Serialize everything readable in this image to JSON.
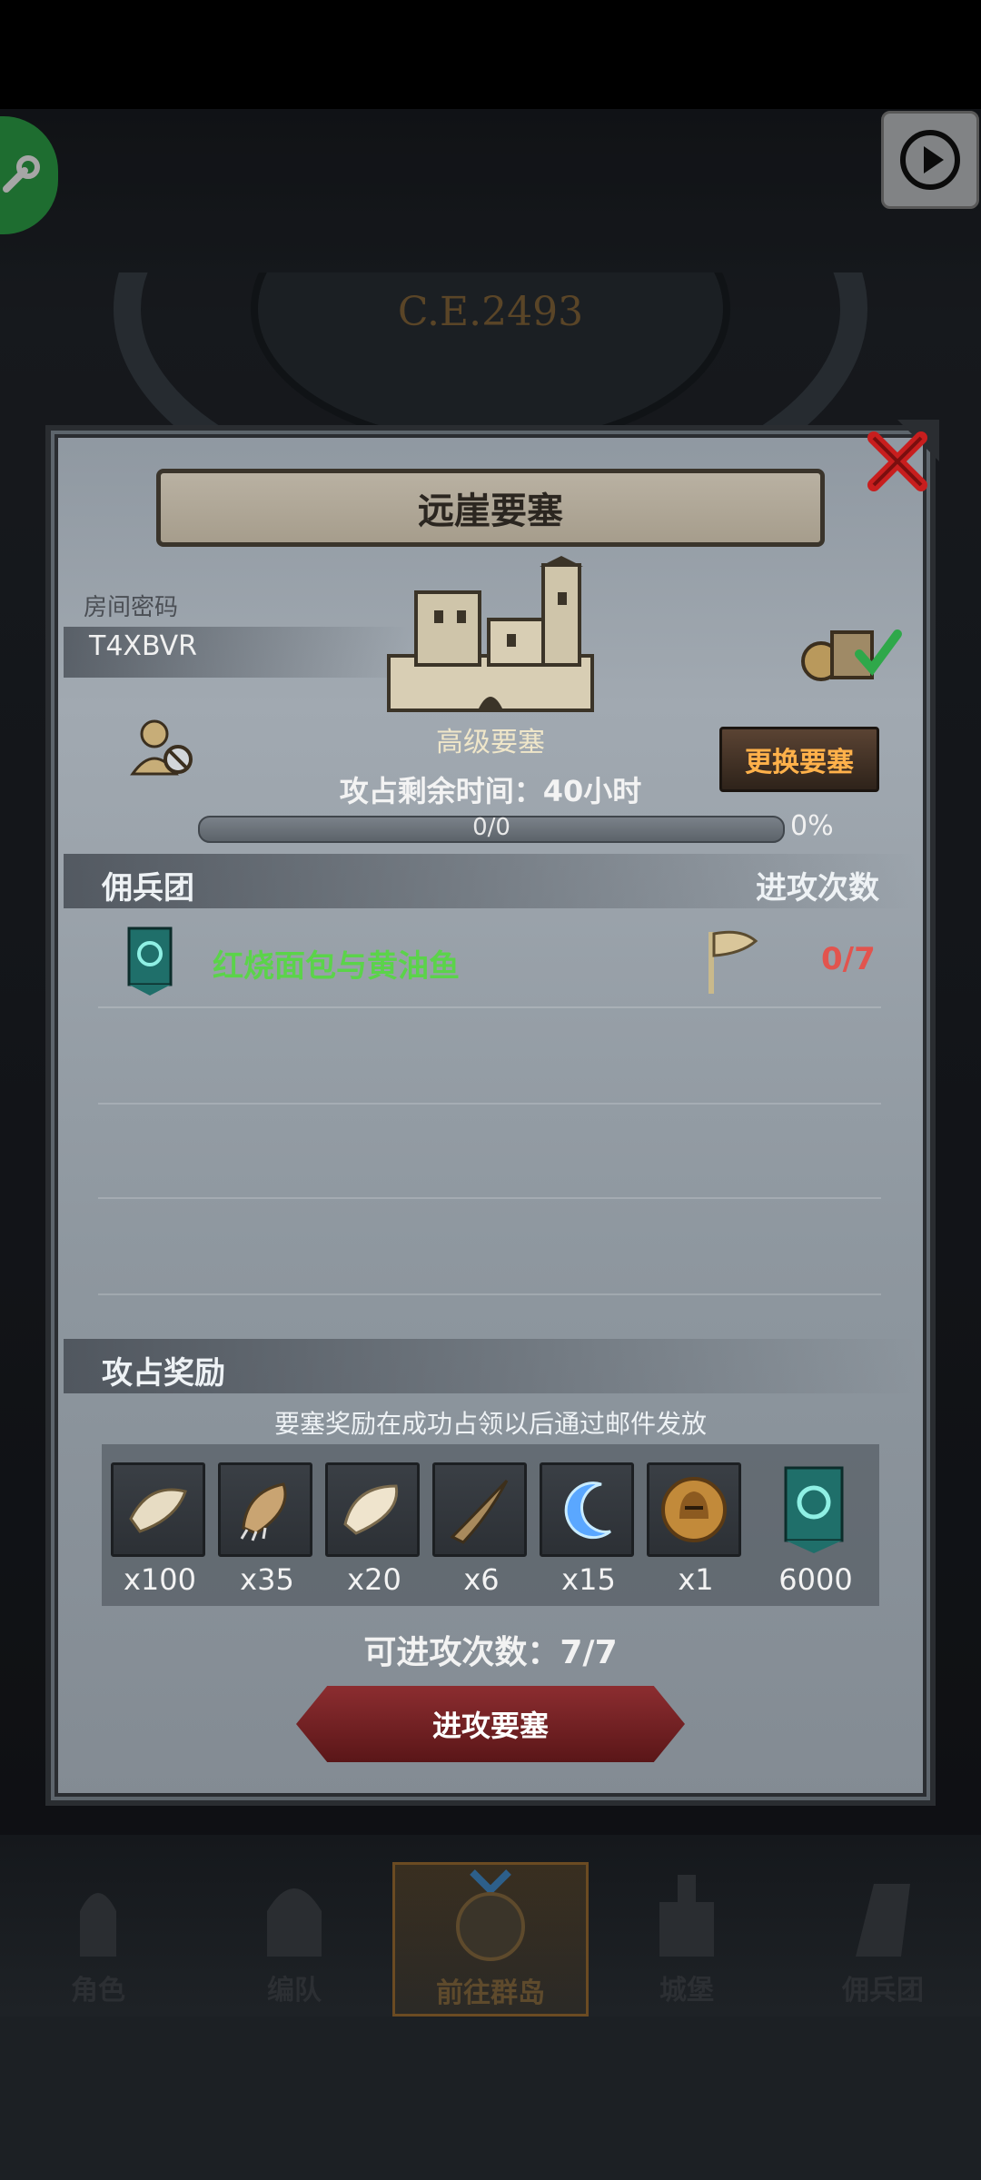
{
  "header": {
    "year_text": "C.E.2493"
  },
  "panel": {
    "title": "远崖要塞",
    "room_password_label": "房间密码",
    "room_password": "T4XBVR",
    "fortress_level": "高级要塞",
    "remaining_time": "攻占剩余时间：40小时",
    "change_button": "更换要塞",
    "progress": {
      "text": "0/0",
      "percent_label": "0%",
      "fraction": 0
    },
    "guild_section": {
      "left": "佣兵团",
      "right": "进攻次数"
    },
    "guilds": [
      {
        "name": "红烧面包与黄油鱼",
        "attacks": "0/7"
      }
    ],
    "reward_section": {
      "title": "攻占奖励"
    },
    "reward_note": "要塞奖励在成功占领以后通过邮件发放",
    "rewards": [
      {
        "icon": "fur-pelt-icon",
        "qty": "x100"
      },
      {
        "icon": "claw-icon",
        "qty": "x35"
      },
      {
        "icon": "wing-icon",
        "qty": "x20"
      },
      {
        "icon": "horn-icon",
        "qty": "x6"
      },
      {
        "icon": "blue-crescent-icon",
        "qty": "x15"
      },
      {
        "icon": "knight-helmet-coin-icon",
        "qty": "x1"
      },
      {
        "icon": "guild-banner-icon",
        "qty": "6000"
      }
    ],
    "attempts_text": "可进攻次数：7/7",
    "attack_button": "进攻要塞"
  },
  "bottom_nav": [
    {
      "label": "角色",
      "icon": "knight-icon"
    },
    {
      "label": "编队",
      "icon": "helmet-icon"
    },
    {
      "label": "前往群岛",
      "icon": "compass-globe-icon"
    },
    {
      "label": "城堡",
      "icon": "castle-icon"
    },
    {
      "label": "佣兵团",
      "icon": "mercenary-icon"
    }
  ],
  "colors": {
    "guild_name": "#5bd34a",
    "attack_count": "#e2544e",
    "change_btn_text": "#ffb14a",
    "attack_btn": "#8c2d30"
  }
}
